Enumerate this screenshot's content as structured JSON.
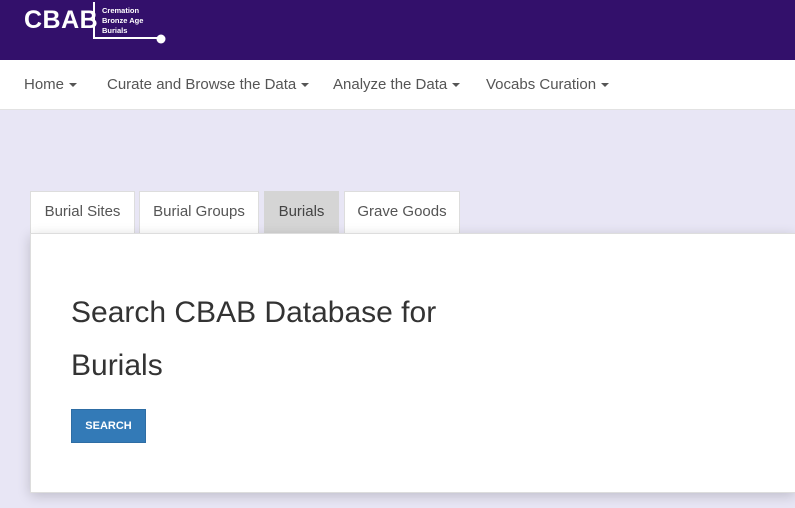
{
  "logo": {
    "main": "CBAB",
    "sub": [
      "Cremation",
      "Bronze Age",
      "Burials"
    ]
  },
  "nav": {
    "items": [
      {
        "label": "Home"
      },
      {
        "label": "Curate and Browse the Data"
      },
      {
        "label": "Analyze the Data"
      },
      {
        "label": "Vocabs Curation"
      }
    ]
  },
  "tabs": [
    {
      "label": "Burial Sites"
    },
    {
      "label": "Burial Groups"
    },
    {
      "label": "Burials",
      "active": true
    },
    {
      "label": "Grave Goods"
    }
  ],
  "panel": {
    "title_line1": "Search CBAB Database for",
    "title_line2": "Burials",
    "search_label": "SEARCH"
  },
  "colors": {
    "topbar": "#33106b",
    "background": "#e8e6f5",
    "button": "#337ab7"
  }
}
